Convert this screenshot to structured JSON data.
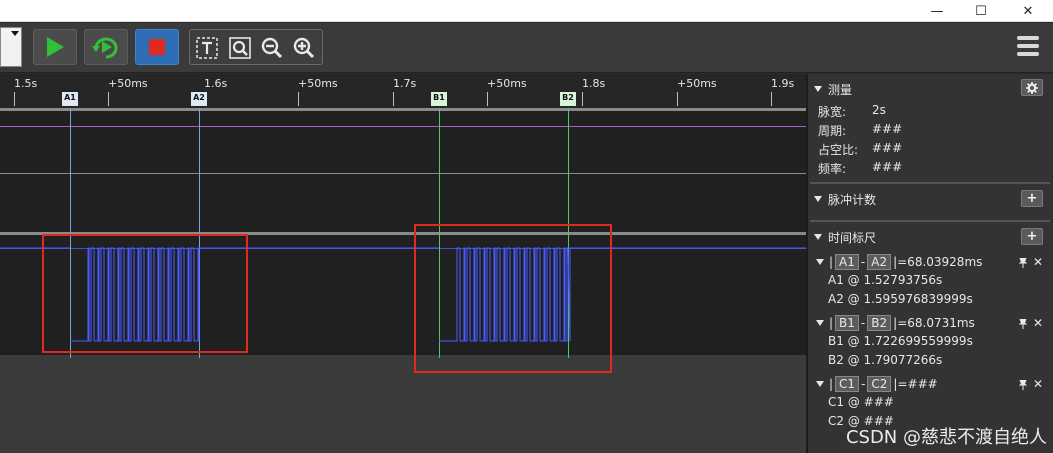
{
  "window": {
    "minimize": "—",
    "maximize": "☐",
    "close": "✕"
  },
  "ruler": {
    "labels": [
      "1.5s",
      "+50ms",
      "1.6s",
      "+50ms",
      "1.7s",
      "+50ms",
      "1.8s",
      "+50ms",
      "1.9s"
    ]
  },
  "markers": {
    "a1": "A1",
    "a2": "A2",
    "b1": "B1",
    "b2": "B2"
  },
  "colors": {
    "accent_blue": "#2d6db5",
    "play_green": "#2fc13a",
    "stop_red": "#e02a20",
    "waveform_blue": "#4a5bff",
    "marker_a": "#7da6cf",
    "marker_b": "#4ecb5f",
    "highlight_box": "#e02a20"
  },
  "panel": {
    "measure": {
      "title": "测量",
      "rows": [
        {
          "key": "脉宽:",
          "value": "2s"
        },
        {
          "key": "周期:",
          "value": "###"
        },
        {
          "key": "占空比:",
          "value": "###"
        },
        {
          "key": "频率:",
          "value": "###"
        }
      ]
    },
    "pulse_count": {
      "title": "脉冲计数",
      "add": "+"
    },
    "time_ruler": {
      "title": "时间标尺",
      "add": "+",
      "pairs": [
        {
          "left": "A1",
          "right": "A2",
          "delta": "=68.03928ms",
          "line1": "A1 @ 1.52793756s",
          "line2": "A2 @ 1.595976839999s"
        },
        {
          "left": "B1",
          "right": "B2",
          "delta": "=68.0731ms",
          "line1": "B1 @ 1.722699559999s",
          "line2": "B2 @ 1.79077266s"
        },
        {
          "left": "C1",
          "right": "C2",
          "delta": "=###",
          "line1": "C1 @ ###",
          "line2": "C2 @ ###"
        }
      ]
    }
  },
  "watermark": "CSDN @慈悲不渡自绝人"
}
